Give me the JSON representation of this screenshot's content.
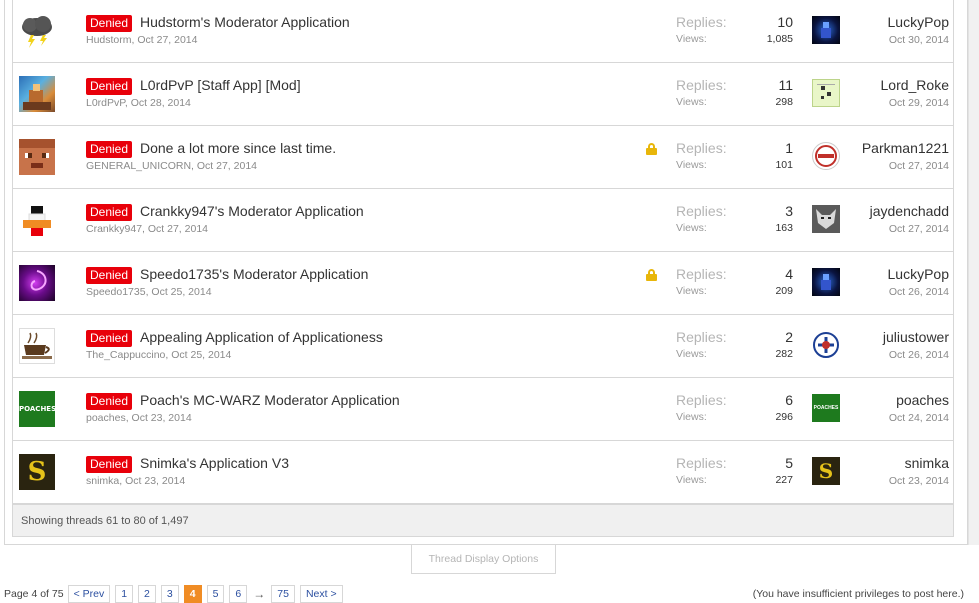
{
  "threads": [
    {
      "prefix": "Denied",
      "title": "Hudstorm's Moderator Application",
      "author": "Hudstorm",
      "date": "Oct 27, 2014",
      "locked": false,
      "replies_label": "Replies:",
      "views_label": "Views:",
      "replies": "10",
      "views": "1,085",
      "last_user": "LuckyPop",
      "last_date": "Oct 30, 2014",
      "avatar_icon": "storm-cloud-icon",
      "last_avatar_icon": "dark-blue-figure-icon"
    },
    {
      "prefix": "Denied",
      "title": "L0rdPvP [Staff App] [Mod]",
      "author": "L0rdPvP",
      "date": "Oct 28, 2014",
      "locked": false,
      "replies_label": "Replies:",
      "views_label": "Views:",
      "replies": "11",
      "views": "298",
      "last_user": "Lord_Roke",
      "last_date": "Oct 29, 2014",
      "avatar_icon": "pixel-landscape-icon",
      "last_avatar_icon": "green-pattern-icon"
    },
    {
      "prefix": "Denied",
      "title": "Done a lot more since last time.",
      "author": "GENERAL_UNICORN",
      "date": "Oct 27, 2014",
      "locked": true,
      "replies_label": "Replies:",
      "views_label": "Views:",
      "replies": "1",
      "views": "101",
      "last_user": "Parkman1221",
      "last_date": "Oct 27, 2014",
      "avatar_icon": "pixel-face-icon",
      "last_avatar_icon": "circle-logo-icon"
    },
    {
      "prefix": "Denied",
      "title": "Crankky947's Moderator Application",
      "author": "Crankky947",
      "date": "Oct 27, 2014",
      "locked": false,
      "replies_label": "Replies:",
      "views_label": "Views:",
      "replies": "3",
      "views": "163",
      "last_user": "jaydenchadd",
      "last_date": "Oct 27, 2014",
      "avatar_icon": "pixel-duck-icon",
      "last_avatar_icon": "wolf-icon"
    },
    {
      "prefix": "Denied",
      "title": "Speedo1735's Moderator Application",
      "author": "Speedo1735",
      "date": "Oct 25, 2014",
      "locked": true,
      "replies_label": "Replies:",
      "views_label": "Views:",
      "replies": "4",
      "views": "209",
      "last_user": "LuckyPop",
      "last_date": "Oct 26, 2014",
      "avatar_icon": "purple-swirl-icon",
      "last_avatar_icon": "dark-blue-figure-icon"
    },
    {
      "prefix": "Denied",
      "title": "Appealing Application of Applicationess",
      "author": "The_Cappuccino",
      "date": "Oct 25, 2014",
      "locked": false,
      "replies_label": "Replies:",
      "views_label": "Views:",
      "replies": "2",
      "views": "282",
      "last_user": "juliustower",
      "last_date": "Oct 26, 2014",
      "avatar_icon": "coffee-cup-icon",
      "last_avatar_icon": "club-crest-icon"
    },
    {
      "prefix": "Denied",
      "title": "Poach's MC-WARZ Moderator Application",
      "author": "poaches",
      "date": "Oct 23, 2014",
      "locked": false,
      "replies_label": "Replies:",
      "views_label": "Views:",
      "replies": "6",
      "views": "296",
      "last_user": "poaches",
      "last_date": "Oct 24, 2014",
      "avatar_icon": "poaches-logo-icon",
      "last_avatar_icon": "poaches-logo-icon"
    },
    {
      "prefix": "Denied",
      "title": "Snimka's Application V3",
      "author": "snimka",
      "date": "Oct 23, 2014",
      "locked": false,
      "replies_label": "Replies:",
      "views_label": "Views:",
      "replies": "5",
      "views": "227",
      "last_user": "snimka",
      "last_date": "Oct 23, 2014",
      "avatar_icon": "gold-s-icon",
      "last_avatar_icon": "gold-s-icon"
    }
  ],
  "footer": {
    "showing": "Showing threads 61 to 80 of 1,497"
  },
  "display_options": "Thread Display Options",
  "pager": {
    "page_count": "Page 4 of 75",
    "prev": "< Prev",
    "pages": [
      "1",
      "2",
      "3",
      "4",
      "5",
      "6"
    ],
    "current": "4",
    "skip": "→",
    "last": "75",
    "next": "Next >"
  },
  "no_privileges": "(You have insufficient privileges to post here.)",
  "colors": {
    "denied_badge": "#e8000a",
    "lock": "#e8b60a",
    "current_page": "#f08c24",
    "link": "#2b4fa0"
  }
}
